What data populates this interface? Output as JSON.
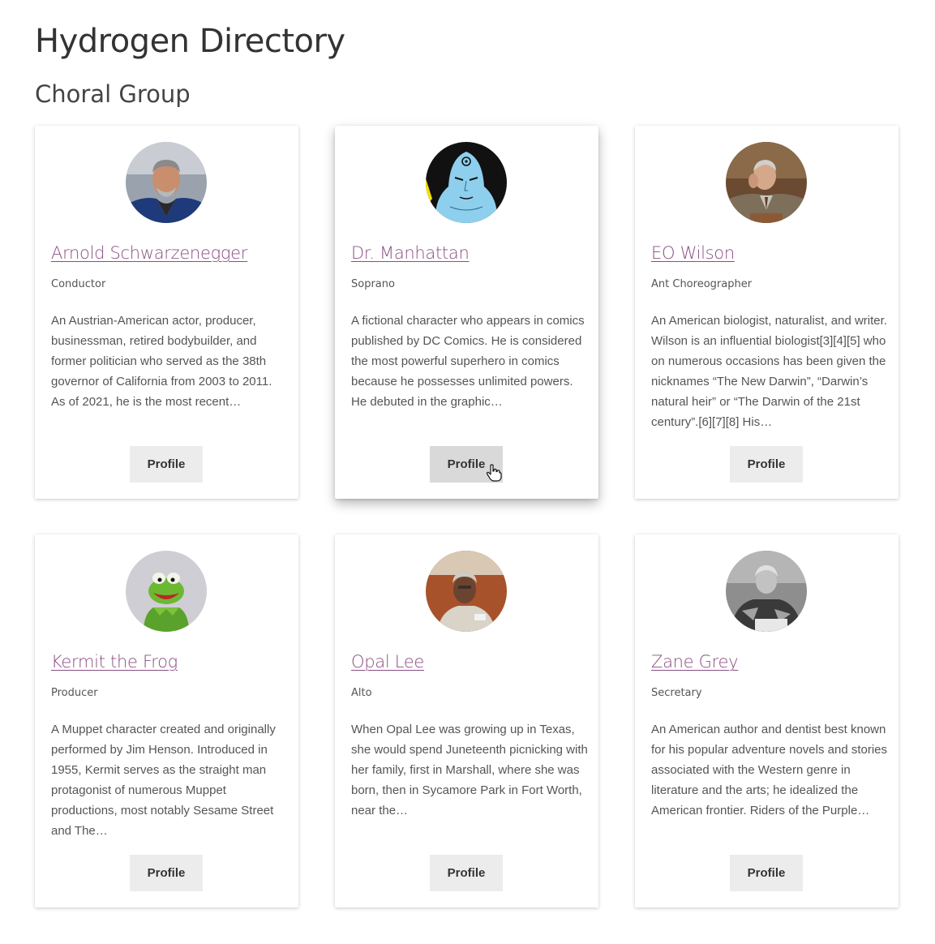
{
  "header": {
    "title": "Hydrogen Directory",
    "group": "Choral Group"
  },
  "people": [
    {
      "name": "Arnold Schwarzenegger",
      "role": "Conductor",
      "description": "An Austrian-American actor, producer, businessman, retired bodybuilder, and former politician who served as the 38th governor of California from 2003 to 2011. As of 2021, he is the most recent…",
      "button": "Profile",
      "avatar": "arnold-photo"
    },
    {
      "name": "Dr. Manhattan",
      "role": "Soprano",
      "description": "A fictional character who appears in comics published by DC Comics. He is considered the most powerful superhero in comics because he possesses unlimited powers. He debuted in the graphic…",
      "button": "Profile",
      "avatar": "dr-manhattan-illustration"
    },
    {
      "name": "EO Wilson",
      "role": "Ant Choreographer",
      "description": "An American biologist, naturalist, and writer. Wilson is an influential biologist[3][4][5] who on numerous occasions has been given the nicknames “The New Darwin”, “Darwin’s natural heir” or “The Darwin of the 21st century”.[6][7][8] His…",
      "button": "Profile",
      "avatar": "eo-wilson-photo"
    },
    {
      "name": "Kermit the Frog",
      "role": "Producer",
      "description": "A Muppet character created and originally performed by Jim Henson. Introduced in 1955, Kermit serves as the straight man protagonist of numerous Muppet productions, most notably Sesame Street and The…",
      "button": "Profile",
      "avatar": "kermit-photo"
    },
    {
      "name": "Opal Lee",
      "role": "Alto",
      "description": "When Opal Lee was growing up in Texas, she would spend Juneteenth picnicking with her family, first in Marshall, where she was born, then in Sycamore Park in Fort Worth, near the…",
      "button": "Profile",
      "avatar": "opal-lee-photo"
    },
    {
      "name": "Zane Grey",
      "role": "Secretary",
      "description": "An American author and dentist best known for his popular adventure novels and stories associated with the Western genre in literature and the arts; he idealized the American frontier. Riders of the Purple…",
      "button": "Profile",
      "avatar": "zane-grey-photo"
    }
  ],
  "colors": {
    "link": "#8a4f82",
    "button_bg": "#ececec",
    "button_hover_bg": "#d9d9d9",
    "text": "#555555"
  }
}
